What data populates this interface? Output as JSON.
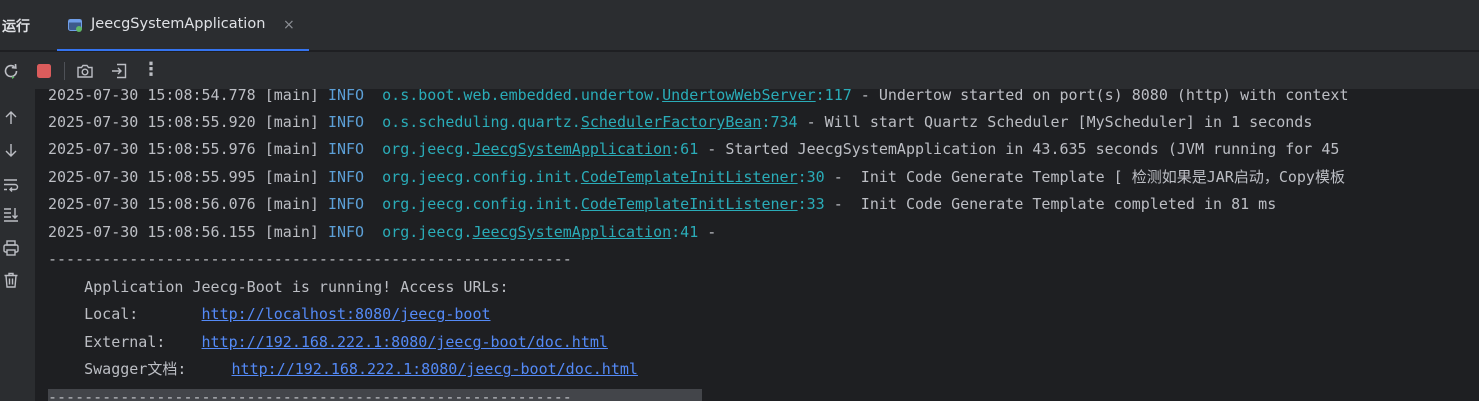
{
  "tool_window": {
    "title": "运行"
  },
  "run_tab": {
    "label": "JeecgSystemApplication",
    "close_glyph": "×"
  },
  "toolbar": {
    "icons": [
      "rerun-icon",
      "stop-icon",
      "camera-icon",
      "exit-icon",
      "more-icon"
    ],
    "more_glyph": "⋮"
  },
  "gutter": {
    "icons": [
      "arrow-up-icon",
      "arrow-down-icon",
      "soft-wrap-icon",
      "scroll-to-end-icon",
      "print-icon",
      "trash-icon"
    ]
  },
  "log_lines": [
    {
      "ts": "2025-07-30 15:08:54.778",
      "thread": "[main]",
      "level": "INFO",
      "logger_pkg": "o.s.boot.web.embedded.undertow.",
      "logger_cls": "UndertowWebServer",
      "logger_line": ":117",
      "message": " - Undertow started on port(s) 8080 (http) with context"
    },
    {
      "ts": "2025-07-30 15:08:55.920",
      "thread": "[main]",
      "level": "INFO",
      "logger_pkg": "o.s.scheduling.quartz.",
      "logger_cls": "SchedulerFactoryBean",
      "logger_line": ":734",
      "message": " - Will start Quartz Scheduler [MyScheduler] in 1 seconds"
    },
    {
      "ts": "2025-07-30 15:08:55.976",
      "thread": "[main]",
      "level": "INFO",
      "logger_pkg": "org.jeecg.",
      "logger_cls": "JeecgSystemApplication",
      "logger_line": ":61",
      "message": " - Started JeecgSystemApplication in 43.635 seconds (JVM running for 45"
    },
    {
      "ts": "2025-07-30 15:08:55.995",
      "thread": "[main]",
      "level": "INFO",
      "logger_pkg": "org.jeecg.config.init.",
      "logger_cls": "CodeTemplateInitListener",
      "logger_line": ":30",
      "message": " -  Init Code Generate Template [ 检测如果是JAR启动，Copy模板"
    },
    {
      "ts": "2025-07-30 15:08:56.076",
      "thread": "[main]",
      "level": "INFO",
      "logger_pkg": "org.jeecg.config.init.",
      "logger_cls": "CodeTemplateInitListener",
      "logger_line": ":33",
      "message": " -  Init Code Generate Template completed in 81 ms"
    },
    {
      "ts": "2025-07-30 15:08:56.155",
      "thread": "[main]",
      "level": "INFO",
      "logger_pkg": "org.jeecg.",
      "logger_cls": "JeecgSystemApplication",
      "logger_line": ":41",
      "message": " -"
    }
  ],
  "banner": {
    "separator": "----------------------------------------------------------",
    "running_line": "    Application Jeecg-Boot is running! Access URLs:",
    "local_label": "    Local:       ",
    "local_url": "http://localhost:8080/jeecg-boot",
    "external_label": "    External:    ",
    "external_url": "http://192.168.222.1:8080/jeecg-boot/doc.html",
    "swagger_label": "    Swagger文档:     ",
    "swagger_url": "http://192.168.222.1:8080/jeecg-boot/doc.html"
  },
  "colors": {
    "background": "#1e1f22",
    "panel": "#2b2d30",
    "text": "#bcbec4",
    "info_level": "#5c9fd6",
    "logger": "#2aacb8",
    "link": "#548af7",
    "stop_red": "#db5c5c",
    "accent": "#3574f0"
  }
}
